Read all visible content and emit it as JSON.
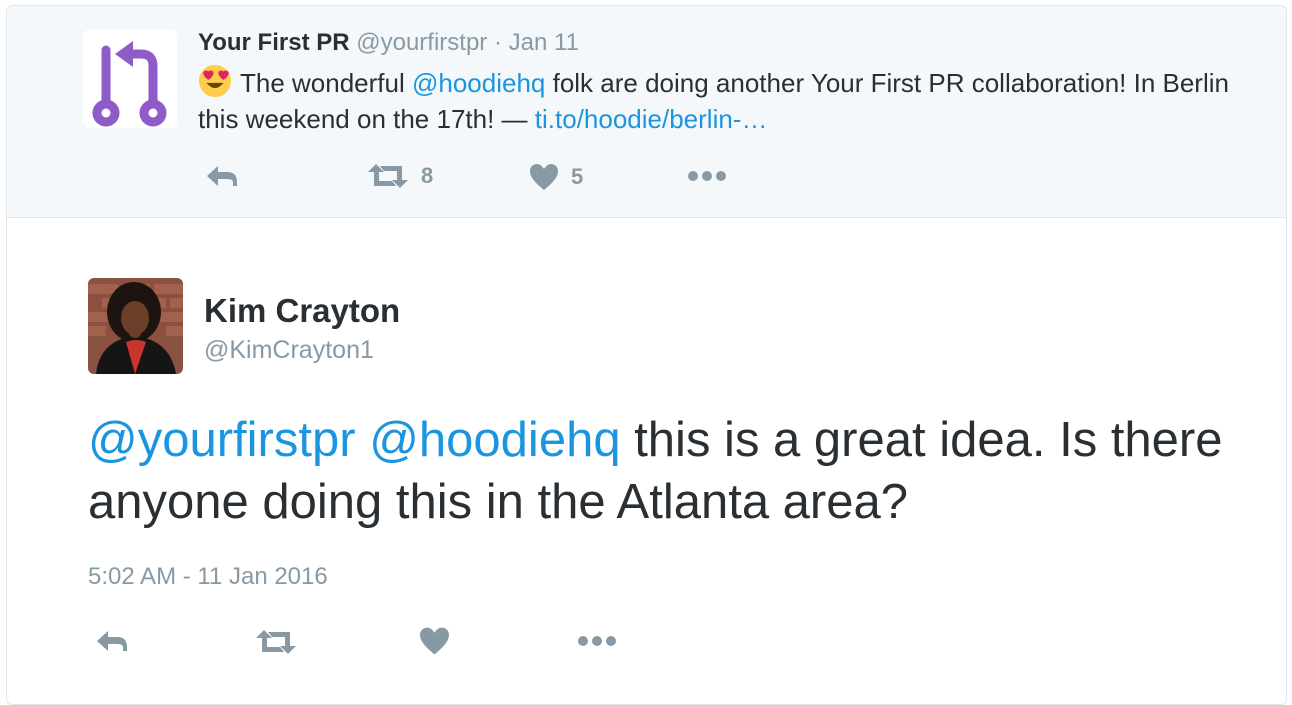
{
  "parent_tweet": {
    "name": "Your First PR",
    "handle": "@yourfirstpr",
    "separator": "·",
    "date": "Jan 11",
    "text_before_mention": "The wonderful ",
    "mention": "@hoodiehq",
    "text_after_mention": " folk are doing another Your First PR collaboration! In Berlin this weekend on the 17th! — ",
    "link": "ti.to/hoodie/berlin-…",
    "retweet_count": "8",
    "like_count": "5",
    "icons": {
      "avatar": "git-pull-request-logo",
      "emoji": "heart-eyes-emoji",
      "reply": "reply-icon",
      "retweet": "retweet-icon",
      "like": "heart-icon",
      "more": "more-icon"
    }
  },
  "main_tweet": {
    "name": "Kim Crayton",
    "handle": "@KimCrayton1",
    "mention_1": "@yourfirstpr",
    "mention_2": "@hoodiehq",
    "text": " this is a great idea. Is there anyone doing this in the Atlanta area?",
    "timestamp": "5:02 AM - 11 Jan 2016",
    "icons": {
      "reply": "reply-icon",
      "retweet": "retweet-icon",
      "like": "heart-icon",
      "more": "more-icon"
    }
  },
  "colors": {
    "link": "#1b95e0",
    "muted": "#8899a6",
    "icon": "#8899a6",
    "logo": "#8e5bc8",
    "text": "#292f33"
  }
}
